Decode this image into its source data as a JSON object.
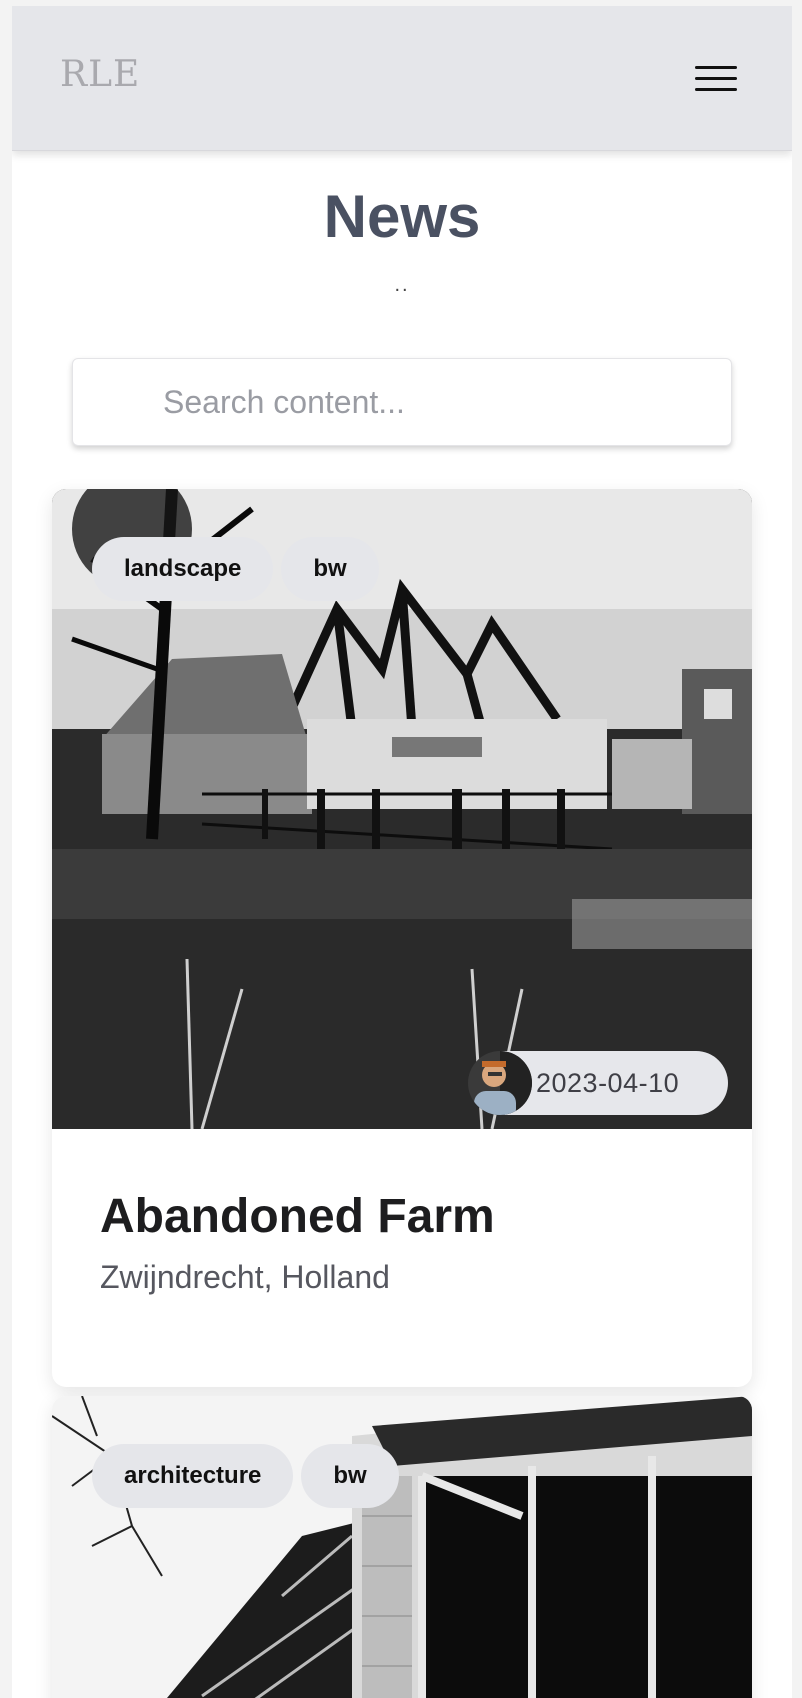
{
  "header": {
    "logo": "RLE",
    "menu_icon": "hamburger-menu-icon"
  },
  "page": {
    "title": "News",
    "subtitle": ".."
  },
  "search": {
    "placeholder": "Search content..."
  },
  "cards": [
    {
      "tags": [
        "landscape",
        "bw"
      ],
      "date": "2023-04-10",
      "title": "Abandoned Farm",
      "location": "Zwijndrecht, Holland"
    },
    {
      "tags": [
        "architecture",
        "bw"
      ]
    }
  ]
}
